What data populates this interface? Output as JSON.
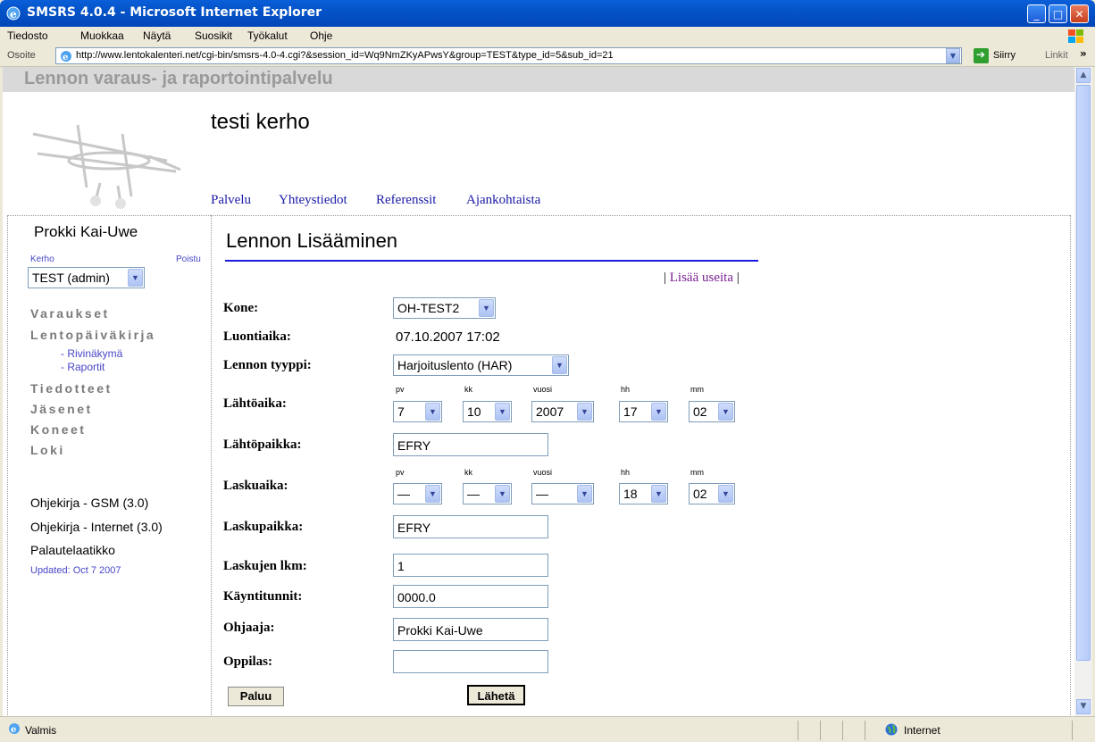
{
  "window": {
    "title": "SMSRS 4.0.4 - Microsoft Internet Explorer"
  },
  "menu": [
    "Tiedosto",
    "Muokkaa",
    "Näytä",
    "Suosikit",
    "Työkalut",
    "Ohje"
  ],
  "address": {
    "label": "Osoite",
    "url": "http://www.lentokalenteri.net/cgi-bin/smsrs-4.0-4.cgi?&session_id=Wq9NmZKyAPwsY&group=TEST&type_id=5&sub_id=21",
    "go_label": "Siirry",
    "links_label": "Linkit"
  },
  "site": {
    "name": "Lennon varaus- ja raportointipalvelu",
    "club": "testi kerho",
    "toplinks": [
      "Palvelu",
      "Yhteystiedot",
      "Referenssit",
      "Ajankohtaista"
    ]
  },
  "sidebar": {
    "user": "Prokki Kai-Uwe",
    "kerho_label": "Kerho",
    "poistu_label": "Poistu",
    "club_select": "TEST (admin)",
    "nav": [
      "Varaukset",
      "Lentopäiväkirja",
      "Tiedotteet",
      "Jäsenet",
      "Koneet",
      "Loki"
    ],
    "subnav": [
      "- Rivinäkymä",
      "- Raportit"
    ],
    "help": [
      "Ohjekirja - GSM (3.0)",
      "Ohjekirja - Internet (3.0)",
      "Palautelaatikko"
    ],
    "updated": "Updated: Oct 7 2007"
  },
  "form": {
    "heading": "Lennon Lisääminen",
    "add_many": "Lisää useita",
    "labels": {
      "kone": "Kone:",
      "luontiaika": "Luontiaika:",
      "tyyppi": "Lennon tyyppi:",
      "lahtoaika": "Lähtöaika:",
      "lahtopaikka": "Lähtöpaikka:",
      "laskuaika": "Laskuaika:",
      "laskupaikka": "Laskupaikka:",
      "laskujen_lkm": "Laskujen lkm:",
      "kayntitunnit": "Käyntitunnit:",
      "ohjaaja": "Ohjaaja:",
      "oppilas": "Oppilas:"
    },
    "values": {
      "kone": "OH-TEST2",
      "luontiaika": "07.10.2007 17:02",
      "tyyppi": "Harjoituslento (HAR)",
      "lahtopaikka": "EFRY",
      "laskupaikka": "EFRY",
      "laskujen_lkm": "1",
      "kayntitunnit": "0000.0",
      "ohjaaja": "Prokki Kai-Uwe",
      "oppilas": ""
    },
    "time_labels": [
      "pv",
      "kk",
      "vuosi",
      "hh",
      "mm"
    ],
    "lahtoaika": {
      "pv": "7",
      "kk": "10",
      "vuosi": "2007",
      "hh": "17",
      "mm": "02"
    },
    "laskuaika": {
      "pv": "—",
      "kk": "—",
      "vuosi": "—",
      "hh": "18",
      "mm": "02"
    },
    "back_button": "Paluu",
    "submit_button": "Lähetä"
  },
  "status": {
    "text": "Valmis",
    "zone": "Internet"
  }
}
